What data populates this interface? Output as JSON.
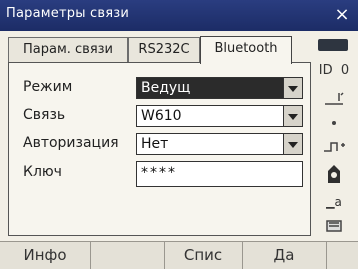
{
  "window": {
    "title": "Параметры связи",
    "close_label": "×"
  },
  "tabs": [
    {
      "label": "Парам. связи",
      "active": false
    },
    {
      "label": "RS232C",
      "active": false
    },
    {
      "label": "Bluetooth",
      "active": true
    }
  ],
  "form": {
    "mode": {
      "label": "Режим",
      "value": "Ведущ"
    },
    "link": {
      "label": "Связь",
      "value": "W610"
    },
    "auth": {
      "label": "Авторизация",
      "value": "Нет"
    },
    "key": {
      "label": "Ключ",
      "value": "****"
    }
  },
  "sidebar": {
    "icons": [
      "battery-icon",
      "id-icon",
      "level-icon",
      "dot-icon",
      "laser-icon",
      "prism-icon",
      "input-mode-icon",
      "keyboard-icon"
    ],
    "id_label": "ID",
    "id_value": "0",
    "mode_label": "a"
  },
  "softkeys": [
    {
      "label": "Инфо"
    },
    {
      "label": ""
    },
    {
      "label": "Спис"
    },
    {
      "label": "Да"
    },
    {
      "label": ""
    }
  ],
  "colors": {
    "titlebar": "#1c2c66",
    "background": "#f2efe6",
    "selection": "#2b2b2b"
  }
}
